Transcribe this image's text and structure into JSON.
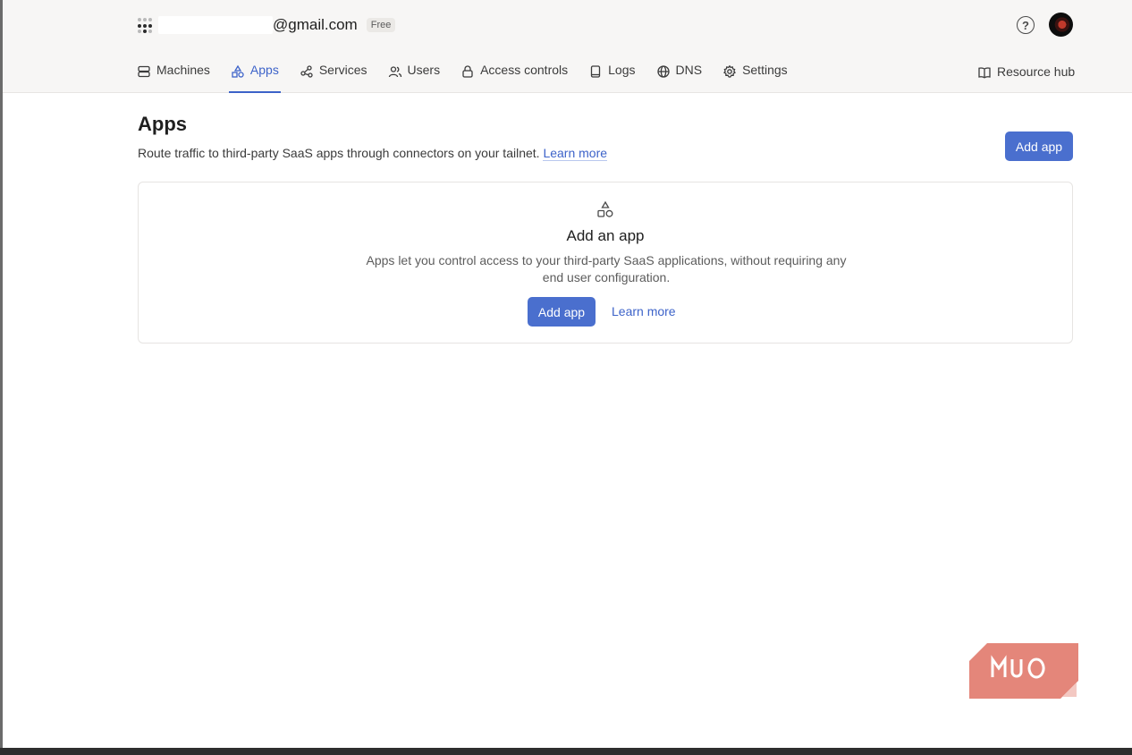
{
  "account": {
    "email_suffix": "@gmail.com",
    "plan": "Free"
  },
  "nav": {
    "items": [
      {
        "label": "Machines",
        "icon": "server-icon",
        "active": false
      },
      {
        "label": "Apps",
        "icon": "shapes-icon",
        "active": true
      },
      {
        "label": "Services",
        "icon": "services-icon",
        "active": false
      },
      {
        "label": "Users",
        "icon": "users-icon",
        "active": false
      },
      {
        "label": "Access controls",
        "icon": "lock-icon",
        "active": false
      },
      {
        "label": "Logs",
        "icon": "logs-icon",
        "active": false
      },
      {
        "label": "DNS",
        "icon": "globe-icon",
        "active": false
      },
      {
        "label": "Settings",
        "icon": "gear-icon",
        "active": false
      }
    ],
    "resource_hub": "Resource hub"
  },
  "header": {
    "help_icon": "?"
  },
  "page": {
    "title": "Apps",
    "description": "Route traffic to third-party SaaS apps through connectors on your tailnet.",
    "learn_more": "Learn more",
    "add_app": "Add app"
  },
  "empty_state": {
    "title": "Add an app",
    "description": "Apps let you control access to your third-party SaaS applications, without requiring any end user configuration.",
    "add_app": "Add app",
    "learn_more": "Learn more"
  },
  "watermark": {
    "text": "MUO"
  },
  "colors": {
    "accent": "#4a6fce",
    "link": "#3d63c9",
    "topbar_bg": "#f7f6f5"
  }
}
